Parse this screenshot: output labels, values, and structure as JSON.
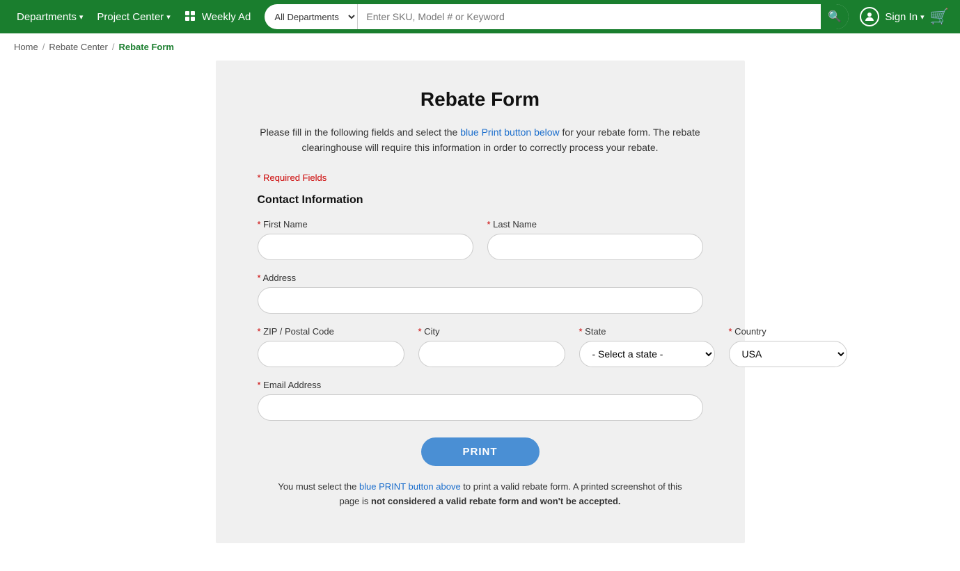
{
  "header": {
    "departments_label": "Departments",
    "project_center_label": "Project Center",
    "weekly_ad_label": "Weekly Ad",
    "search_placeholder": "Enter SKU, Model # or Keyword",
    "search_department_default": "All Departments",
    "sign_in_label": "Sign In"
  },
  "breadcrumb": {
    "home": "Home",
    "rebate_center": "Rebate Center",
    "current": "Rebate Form"
  },
  "form": {
    "title": "Rebate Form",
    "description_part1": "Please fill in the following fields and select the blue Print button below for your rebate form. The rebate clearinghouse will require this information in order to correctly process your rebate.",
    "required_note": "* Required Fields",
    "section_contact": "Contact Information",
    "first_name_label": "* First Name",
    "last_name_label": "* Last Name",
    "address_label": "* Address",
    "zip_label": "* ZIP / Postal Code",
    "city_label": "* City",
    "state_label": "* State",
    "state_default": "- Select a state -",
    "country_label": "* Country",
    "country_default": "USA",
    "email_label": "* Email Address",
    "print_button": "PRINT",
    "print_note": "You must select the blue PRINT button above to print a valid rebate form. A printed screenshot of this page is not considered a valid rebate form and won't be accepted."
  }
}
